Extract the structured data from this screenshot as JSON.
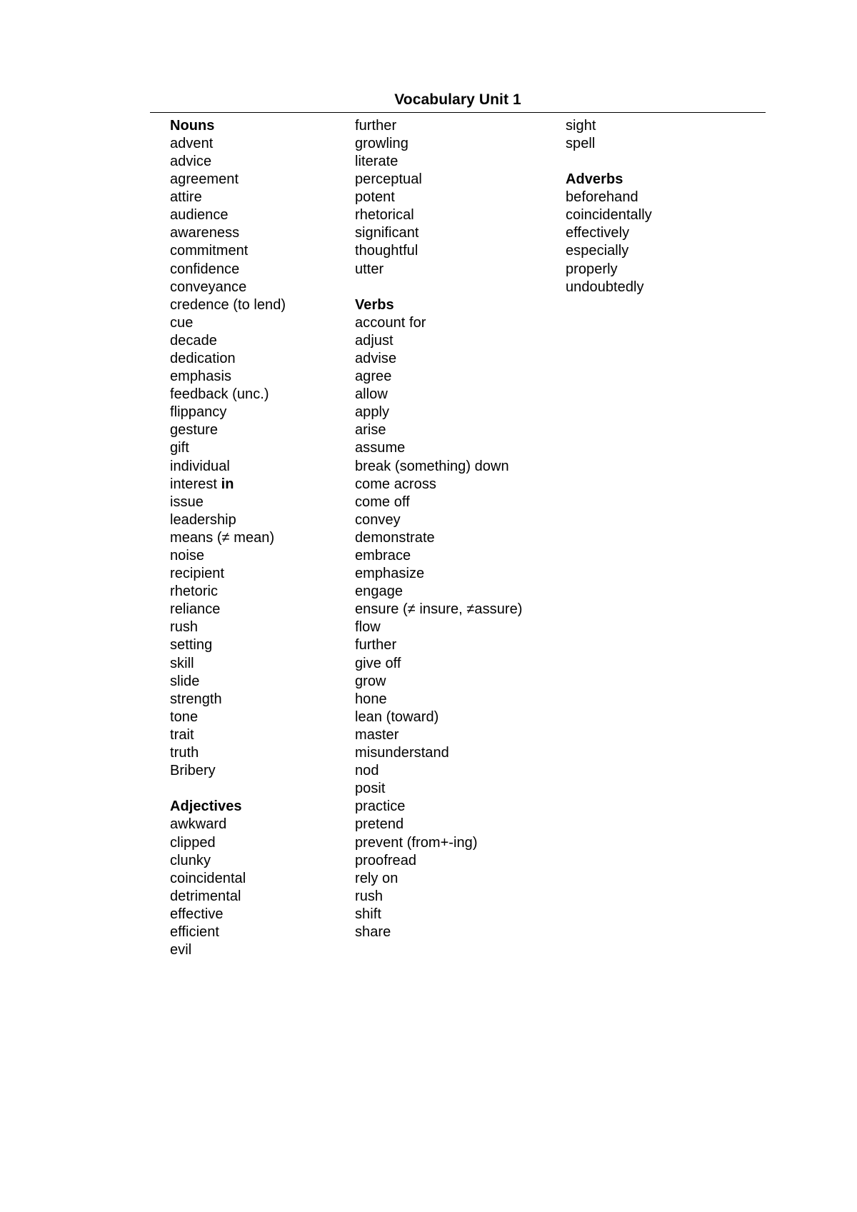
{
  "document": {
    "title": "Vocabulary Unit 1"
  },
  "columns": [
    {
      "name": "column-1",
      "entries": [
        {
          "text": "Nouns",
          "style": "header"
        },
        {
          "text": "advent",
          "style": "normal"
        },
        {
          "text": "advice",
          "style": "normal"
        },
        {
          "text": "agreement",
          "style": "normal"
        },
        {
          "text": "attire",
          "style": "normal"
        },
        {
          "text": "audience",
          "style": "normal"
        },
        {
          "text": "awareness",
          "style": "normal"
        },
        {
          "text": "commitment",
          "style": "normal"
        },
        {
          "text": "confidence",
          "style": "normal"
        },
        {
          "text": "conveyance",
          "style": "normal"
        },
        {
          "text": "credence (to lend)",
          "style": "normal"
        },
        {
          "text": "cue",
          "style": "normal"
        },
        {
          "text": "decade",
          "style": "normal"
        },
        {
          "text": "dedication",
          "style": "normal"
        },
        {
          "text": "emphasis",
          "style": "normal"
        },
        {
          "text": "feedback (unc.)",
          "style": "normal"
        },
        {
          "text": "flippancy",
          "style": "normal"
        },
        {
          "text": "gesture",
          "style": "normal"
        },
        {
          "text": "gift",
          "style": "normal"
        },
        {
          "text": "individual",
          "style": "normal"
        },
        {
          "text": "interest in",
          "style": "partial-bold",
          "bold_suffix": "in",
          "plain_prefix": "interest "
        },
        {
          "text": "issue",
          "style": "normal"
        },
        {
          "text": "leadership",
          "style": "normal"
        },
        {
          "text": "means (≠ mean)",
          "style": "normal"
        },
        {
          "text": "noise",
          "style": "normal"
        },
        {
          "text": "recipient",
          "style": "normal"
        },
        {
          "text": "rhetoric",
          "style": "normal"
        },
        {
          "text": "reliance",
          "style": "normal"
        },
        {
          "text": "rush",
          "style": "normal"
        },
        {
          "text": "setting",
          "style": "normal"
        },
        {
          "text": "skill",
          "style": "normal"
        },
        {
          "text": "slide",
          "style": "normal"
        },
        {
          "text": "strength",
          "style": "normal"
        },
        {
          "text": "tone",
          "style": "normal"
        },
        {
          "text": "trait",
          "style": "normal"
        },
        {
          "text": "truth",
          "style": "normal"
        },
        {
          "text": "Bribery",
          "style": "normal"
        },
        {
          "text": "",
          "style": "spacer"
        },
        {
          "text": "Adjectives",
          "style": "header"
        },
        {
          "text": "awkward",
          "style": "normal"
        },
        {
          "text": "clipped",
          "style": "normal"
        },
        {
          "text": "clunky",
          "style": "normal"
        },
        {
          "text": "coincidental",
          "style": "normal"
        },
        {
          "text": "detrimental",
          "style": "normal"
        },
        {
          "text": "effective",
          "style": "normal"
        },
        {
          "text": "efficient",
          "style": "normal"
        },
        {
          "text": "evil",
          "style": "normal"
        }
      ]
    },
    {
      "name": "column-2",
      "entries": [
        {
          "text": "further",
          "style": "normal"
        },
        {
          "text": "growling",
          "style": "normal"
        },
        {
          "text": "literate",
          "style": "normal"
        },
        {
          "text": "perceptual",
          "style": "normal"
        },
        {
          "text": "potent",
          "style": "normal"
        },
        {
          "text": "rhetorical",
          "style": "normal"
        },
        {
          "text": "significant",
          "style": "normal"
        },
        {
          "text": "thoughtful",
          "style": "normal"
        },
        {
          "text": "utter",
          "style": "normal"
        },
        {
          "text": "",
          "style": "spacer"
        },
        {
          "text": "Verbs",
          "style": "header"
        },
        {
          "text": "account for",
          "style": "normal"
        },
        {
          "text": "adjust",
          "style": "normal"
        },
        {
          "text": "advise",
          "style": "normal"
        },
        {
          "text": "agree",
          "style": "normal"
        },
        {
          "text": "allow",
          "style": "normal"
        },
        {
          "text": "apply",
          "style": "normal"
        },
        {
          "text": "arise",
          "style": "normal"
        },
        {
          "text": "assume",
          "style": "normal"
        },
        {
          "text": "break (something) down",
          "style": "normal"
        },
        {
          "text": "come across",
          "style": "normal"
        },
        {
          "text": "come off",
          "style": "normal"
        },
        {
          "text": "convey",
          "style": "normal"
        },
        {
          "text": "demonstrate",
          "style": "normal"
        },
        {
          "text": "embrace",
          "style": "normal"
        },
        {
          "text": "emphasize",
          "style": "normal"
        },
        {
          "text": "engage",
          "style": "normal"
        },
        {
          "text": "ensure (≠ insure, ≠assure)",
          "style": "normal"
        },
        {
          "text": "flow",
          "style": "normal"
        },
        {
          "text": "further",
          "style": "normal"
        },
        {
          "text": "give off",
          "style": "normal"
        },
        {
          "text": "grow",
          "style": "normal"
        },
        {
          "text": "hone",
          "style": "normal"
        },
        {
          "text": "lean (toward)",
          "style": "normal"
        },
        {
          "text": "master",
          "style": "normal"
        },
        {
          "text": "misunderstand",
          "style": "normal"
        },
        {
          "text": "nod",
          "style": "normal"
        },
        {
          "text": "posit",
          "style": "normal"
        },
        {
          "text": "practice",
          "style": "normal"
        },
        {
          "text": "pretend",
          "style": "normal"
        },
        {
          "text": "prevent (from+-ing)",
          "style": "normal"
        },
        {
          "text": "proofread",
          "style": "normal"
        },
        {
          "text": "rely on",
          "style": "normal"
        },
        {
          "text": "rush",
          "style": "normal"
        },
        {
          "text": "shift",
          "style": "normal"
        },
        {
          "text": "share",
          "style": "normal"
        }
      ]
    },
    {
      "name": "column-3",
      "entries": [
        {
          "text": "sight",
          "style": "normal"
        },
        {
          "text": "spell",
          "style": "normal"
        },
        {
          "text": "",
          "style": "spacer"
        },
        {
          "text": "Adverbs",
          "style": "header"
        },
        {
          "text": "beforehand",
          "style": "normal"
        },
        {
          "text": "coincidentally",
          "style": "normal"
        },
        {
          "text": "effectively",
          "style": "normal"
        },
        {
          "text": "especially",
          "style": "normal"
        },
        {
          "text": "properly",
          "style": "normal"
        },
        {
          "text": "undoubtedly",
          "style": "normal"
        }
      ]
    }
  ]
}
